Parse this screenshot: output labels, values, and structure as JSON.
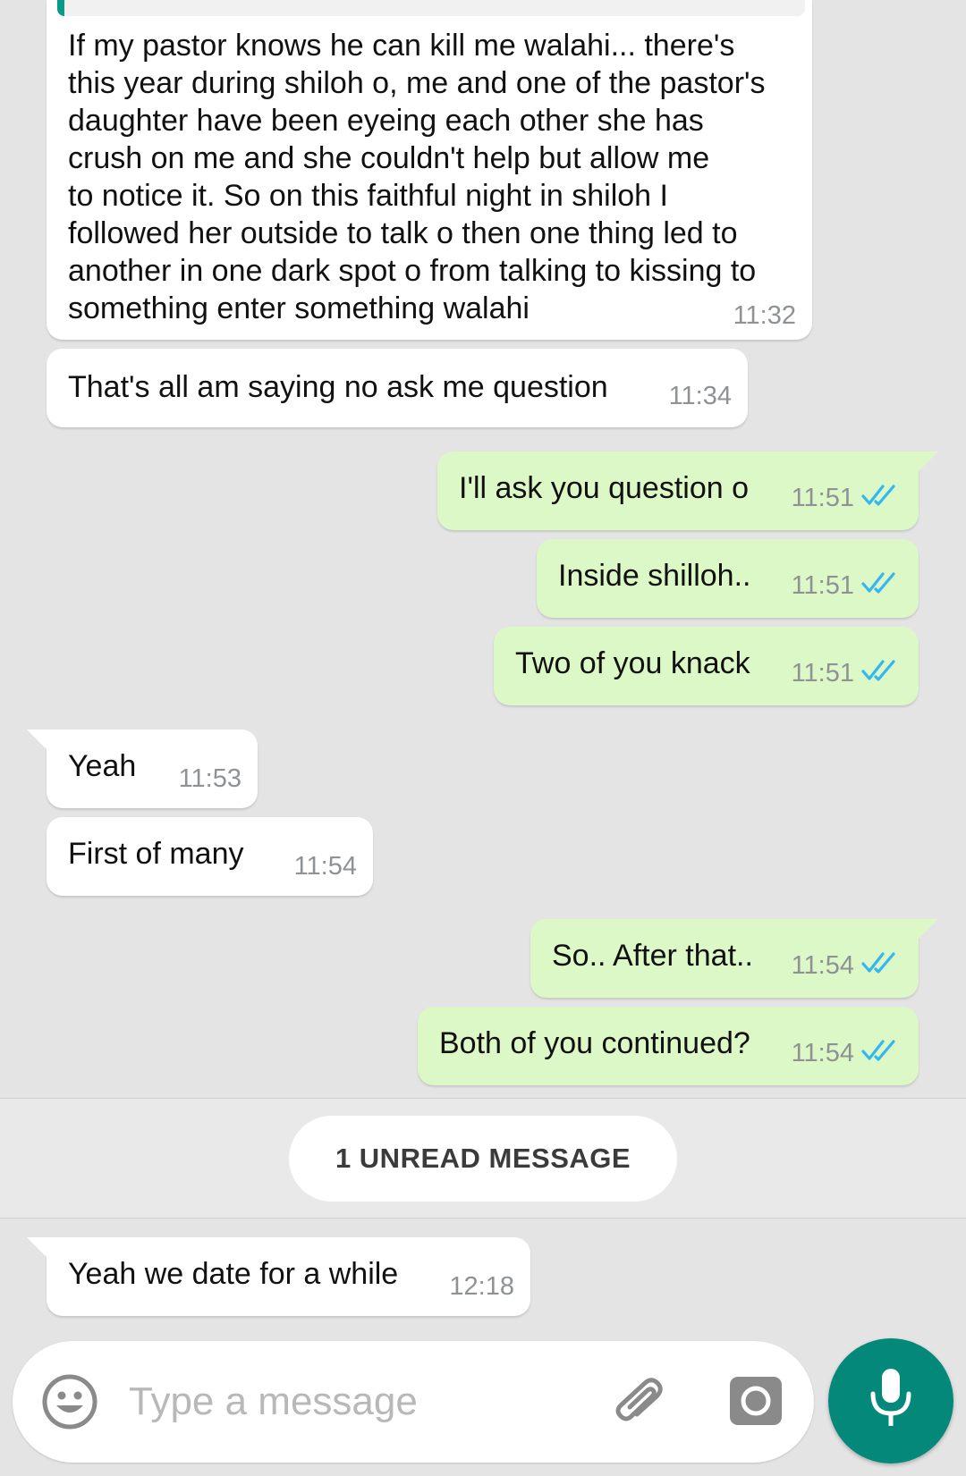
{
  "messages": [
    {
      "dir": "in",
      "text": "If my pastor knows he can kill me walahi... there's\nthis year during shiloh o, me and one of the pastor's\ndaughter have been eyeing each other she has\ncrush on me and she couldn't help but allow me\nto notice it. So on this faithful night in shiloh I\nfollowed her outside to talk o then one thing led to\nanother in one dark spot o from talking to kissing to\nsomething enter something walahi",
      "time": "11:32"
    },
    {
      "dir": "in",
      "text": "That's all am saying no ask me question",
      "time": "11:34"
    },
    {
      "dir": "out",
      "text": "I'll ask you question o",
      "time": "11:51"
    },
    {
      "dir": "out",
      "text": "Inside shilloh..",
      "time": "11:51"
    },
    {
      "dir": "out",
      "text": "Two of you knack",
      "time": "11:51"
    },
    {
      "dir": "in",
      "text": "Yeah",
      "time": "11:53"
    },
    {
      "dir": "in",
      "text": "First of many",
      "time": "11:54"
    },
    {
      "dir": "out",
      "text": "So.. After that..",
      "time": "11:54"
    },
    {
      "dir": "out",
      "text": "Both of you continued?",
      "time": "11:54"
    },
    {
      "dir": "in",
      "text": "Yeah we date for a while",
      "time": "12:18"
    }
  ],
  "unread": {
    "label": "1 UNREAD MESSAGE"
  },
  "composer": {
    "placeholder": "Type a message"
  },
  "colors": {
    "background": "#e4e4e4",
    "incoming_bubble": "#ffffff",
    "outgoing_bubble": "#dcf8c6",
    "read_ticks": "#34b7f1",
    "mic_button": "#04887a",
    "quote_accent": "#0a9a8a"
  },
  "icons": {
    "read_receipt": "double-check-icon",
    "emoji": "smiley-icon",
    "attach": "paperclip-icon",
    "camera": "camera-icon",
    "mic": "microphone-icon"
  }
}
